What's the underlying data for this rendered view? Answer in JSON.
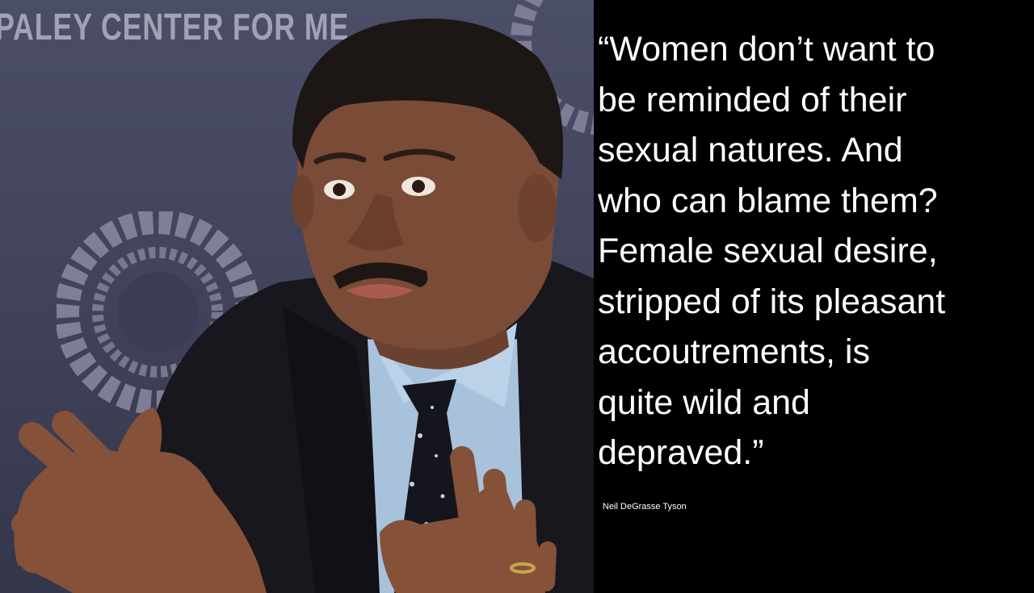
{
  "photo": {
    "backdrop_text": "PALEY CENTER FOR ME",
    "alt": "Neil DeGrasse Tyson speaking and gesturing with both hands in front of a Paley Center for Media backdrop"
  },
  "quote": {
    "lines": [
      "“Women don’t want to",
      "be reminded of their",
      "sexual natures. And",
      "who can blame them?",
      "Female sexual desire,",
      "stripped of its pleasant",
      "accoutrements, is",
      "quite wild and",
      "depraved.”"
    ],
    "attribution": "Neil DeGrasse Tyson"
  },
  "colors": {
    "backdrop": "#434660",
    "backdrop_text": "#a3a2b5",
    "quote_background": "#000000",
    "quote_text": "#ffffff"
  }
}
